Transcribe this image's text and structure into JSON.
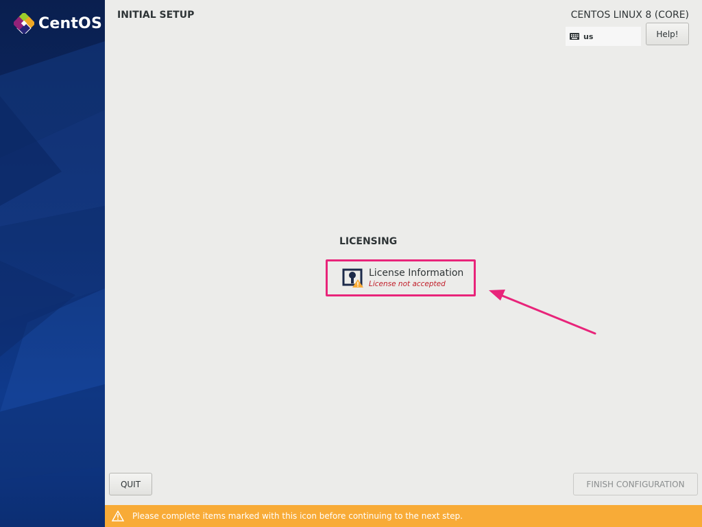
{
  "sidebar": {
    "logo_text": "CentOS",
    "logo_icon": "centos-logo-icon"
  },
  "header": {
    "title": "INITIAL SETUP",
    "product": "CENTOS LINUX 8 (CORE)",
    "keyboard_layout": "us",
    "keyboard_icon": "keyboard-icon",
    "help_label": "Help!"
  },
  "main": {
    "section_title": "LICENSING",
    "spoke": {
      "title": "License Information",
      "status": "License not accepted",
      "icon": "license-warning-icon"
    }
  },
  "footer": {
    "quit_label": "QUIT",
    "finish_label": "FINISH CONFIGURATION",
    "warning_text": "Please complete items marked with this icon before continuing to the next step.",
    "warning_icon": "warning-icon"
  },
  "colors": {
    "sidebar_bg": "#0d2b6b",
    "warning_bar": "#f8ab37",
    "highlight": "#e8247a",
    "status_error": "#c01c28"
  }
}
